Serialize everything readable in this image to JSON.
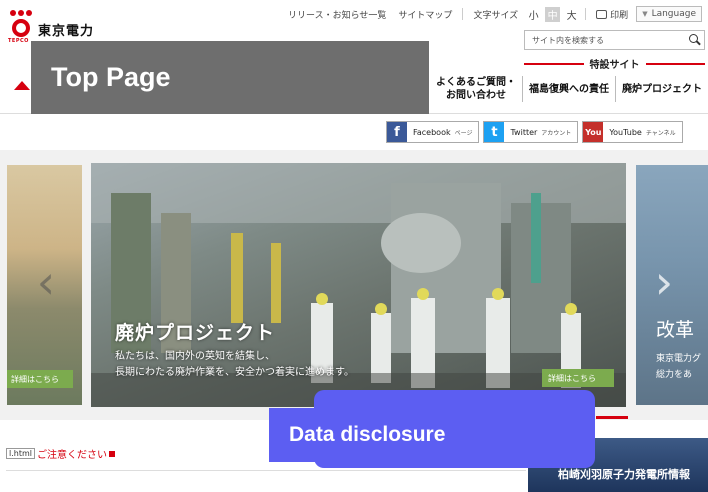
{
  "header": {
    "logo_name": "東京電力",
    "logo_sub": "TEPCO",
    "utility_links": [
      "リリース・お知らせ一覧",
      "サイトマップ"
    ],
    "font_size_label": "文字サイズ",
    "font_sizes": [
      "小",
      "中",
      "大"
    ],
    "print_label": "印刷",
    "language_label": "Language",
    "search_placeholder": "サイト内を検索する",
    "special_site": "特設サイト",
    "nav": [
      {
        "label_line1": "よくあるご質問・",
        "label_line2": "お問い合わせ"
      },
      {
        "label": "福島復興への責任"
      },
      {
        "label": "廃炉プロジェクト"
      }
    ]
  },
  "overlay_labels": {
    "top_page": "Top Page",
    "data_disclosure": "Data disclosure"
  },
  "social": {
    "facebook": {
      "label": "Facebook",
      "sub": "ページ"
    },
    "twitter": {
      "label": "Twitter",
      "sub": "アカウント"
    },
    "youtube": {
      "label": "YouTube",
      "sub": "チャンネル",
      "icon_text": "You"
    }
  },
  "carousel": {
    "left_button": "詳細はこちら",
    "main_title": "廃炉プロジェクト",
    "main_desc_line1": "私たちは、国内外の英知を結集し、",
    "main_desc_line2": "長期にわたる廃炉作業を、安全かつ着実に進めます。",
    "main_button": "詳細はこちら",
    "right_title": "改革",
    "right_desc_line1": "東京電力グ",
    "right_desc_line2": "総力をあ"
  },
  "bottom": {
    "file_label": "l.html",
    "notice": "ご注意ください",
    "news_strip": "柏崎刈羽原子力発電所情報"
  },
  "colors": {
    "brand_red": "#d6000f",
    "overlay_gray": "#6e6e6e",
    "overlay_blue": "#5c5ef2",
    "detail_green": "#7cab4e"
  }
}
